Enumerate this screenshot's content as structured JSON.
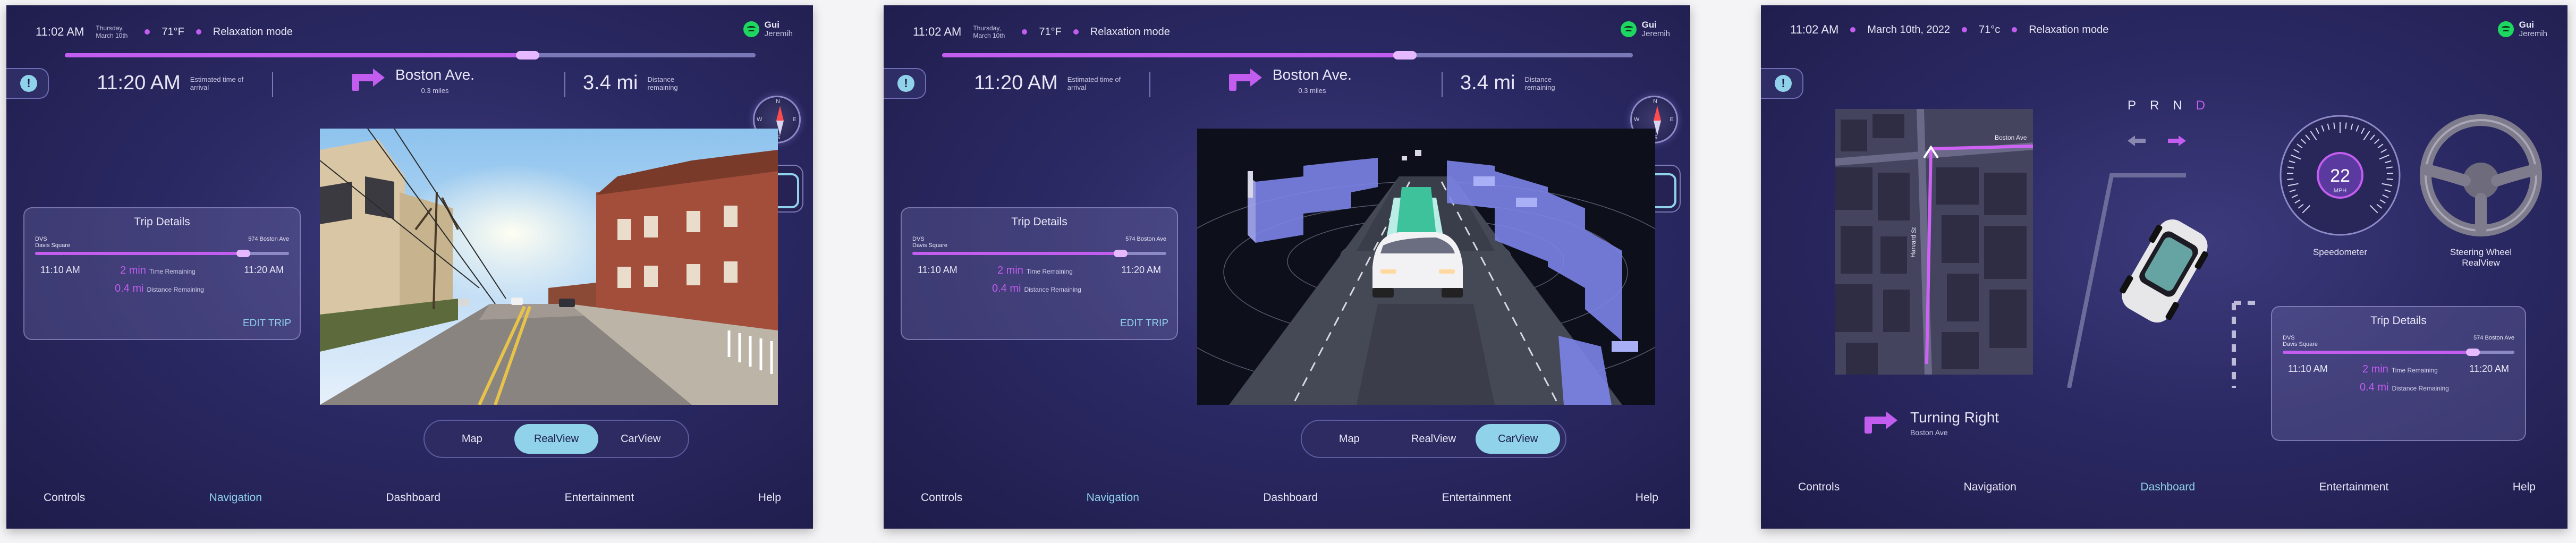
{
  "screens": [
    {
      "status": {
        "time": "11:02 AM",
        "date": "Thursday, March 10th",
        "temp": "71°F",
        "mode": "Relaxation mode"
      },
      "user": {
        "name": "Gui",
        "handle": "Jeremih"
      },
      "nav": {
        "eta": "11:20 AM",
        "eta_label": "Estimated time of arrival",
        "street": "Boston Ave.",
        "street_dist": "0.3 miles",
        "distance": "3.4 mi",
        "distance_label": "Distance remaining",
        "progress": 0.67
      },
      "compass": {
        "n": "N",
        "s": "S",
        "e": "E",
        "w": "W"
      },
      "trip": {
        "title": "Trip Details",
        "from_code": "DVS",
        "from_name": "Davis Square",
        "to_name": "574 Boston Ave",
        "progress": 0.82,
        "start_time": "11:10 AM",
        "end_time": "11:20 AM",
        "time_remaining": "2 min",
        "time_remaining_label": "Time Remaining",
        "distance_remaining": "0.4 mi",
        "distance_remaining_label": "Distance Remaining",
        "edit": "EDIT TRIP"
      },
      "segments": [
        "Map",
        "RealView",
        "CarView"
      ],
      "active_segment": 1,
      "bottom_nav": [
        "Controls",
        "Navigation",
        "Dashboard",
        "Entertainment",
        "Help"
      ],
      "active_nav": 1,
      "view": "street",
      "alert": "!"
    },
    {
      "status": {
        "time": "11:02 AM",
        "date": "Thursday, March 10th",
        "temp": "71°F",
        "mode": "Relaxation mode"
      },
      "user": {
        "name": "Gui",
        "handle": "Jeremih"
      },
      "nav": {
        "eta": "11:20 AM",
        "eta_label": "Estimated time of arrival",
        "street": "Boston Ave.",
        "street_dist": "0.3 miles",
        "distance": "3.4 mi",
        "distance_label": "Distance remaining",
        "progress": 0.67
      },
      "compass": {
        "n": "N",
        "s": "S",
        "e": "E",
        "w": "W"
      },
      "trip": {
        "title": "Trip Details",
        "from_code": "DVS",
        "from_name": "Davis Square",
        "to_name": "574 Boston Ave",
        "progress": 0.82,
        "start_time": "11:10 AM",
        "end_time": "11:20 AM",
        "time_remaining": "2 min",
        "time_remaining_label": "Time Remaining",
        "distance_remaining": "0.4 mi",
        "distance_remaining_label": "Distance Remaining",
        "edit": "EDIT TRIP"
      },
      "segments": [
        "Map",
        "RealView",
        "CarView"
      ],
      "active_segment": 2,
      "bottom_nav": [
        "Controls",
        "Navigation",
        "Dashboard",
        "Entertainment",
        "Help"
      ],
      "active_nav": 1,
      "view": "lidar",
      "alert": "!"
    },
    {
      "status": {
        "time": "11:02 AM",
        "date": "March 10th, 2022",
        "temp": "71°c",
        "mode": "Relaxation mode"
      },
      "user": {
        "name": "Gui",
        "handle": "Jeremih"
      },
      "gears": [
        "P",
        "R",
        "N",
        "D"
      ],
      "active_gear": 3,
      "speed": "22",
      "speed_unit": "MPH",
      "speedometer_label": "Speedometer",
      "wheel_label_1": "Steering Wheel",
      "wheel_label_2": "RealView",
      "map_labels": {
        "top_street": "Boston Ave",
        "side_street": "Harvard St"
      },
      "turning": {
        "title": "Turning Right",
        "street": "Boston Ave"
      },
      "trip": {
        "title": "Trip Details",
        "from_code": "DVS",
        "from_name": "Davis Square",
        "to_name": "574 Boston Ave",
        "progress": 0.82,
        "start_time": "11:10 AM",
        "end_time": "11:20 AM",
        "time_remaining": "2 min",
        "time_remaining_label": "Time Remaining",
        "distance_remaining": "0.4 mi",
        "distance_remaining_label": "Distance Remaining"
      },
      "bottom_nav": [
        "Controls",
        "Navigation",
        "Dashboard",
        "Entertainment",
        "Help"
      ],
      "active_nav": 2,
      "alert": "!"
    }
  ],
  "colors": {
    "accent": "#c35df0",
    "highlight": "#8fd2ea",
    "bg": "#2b2963"
  }
}
